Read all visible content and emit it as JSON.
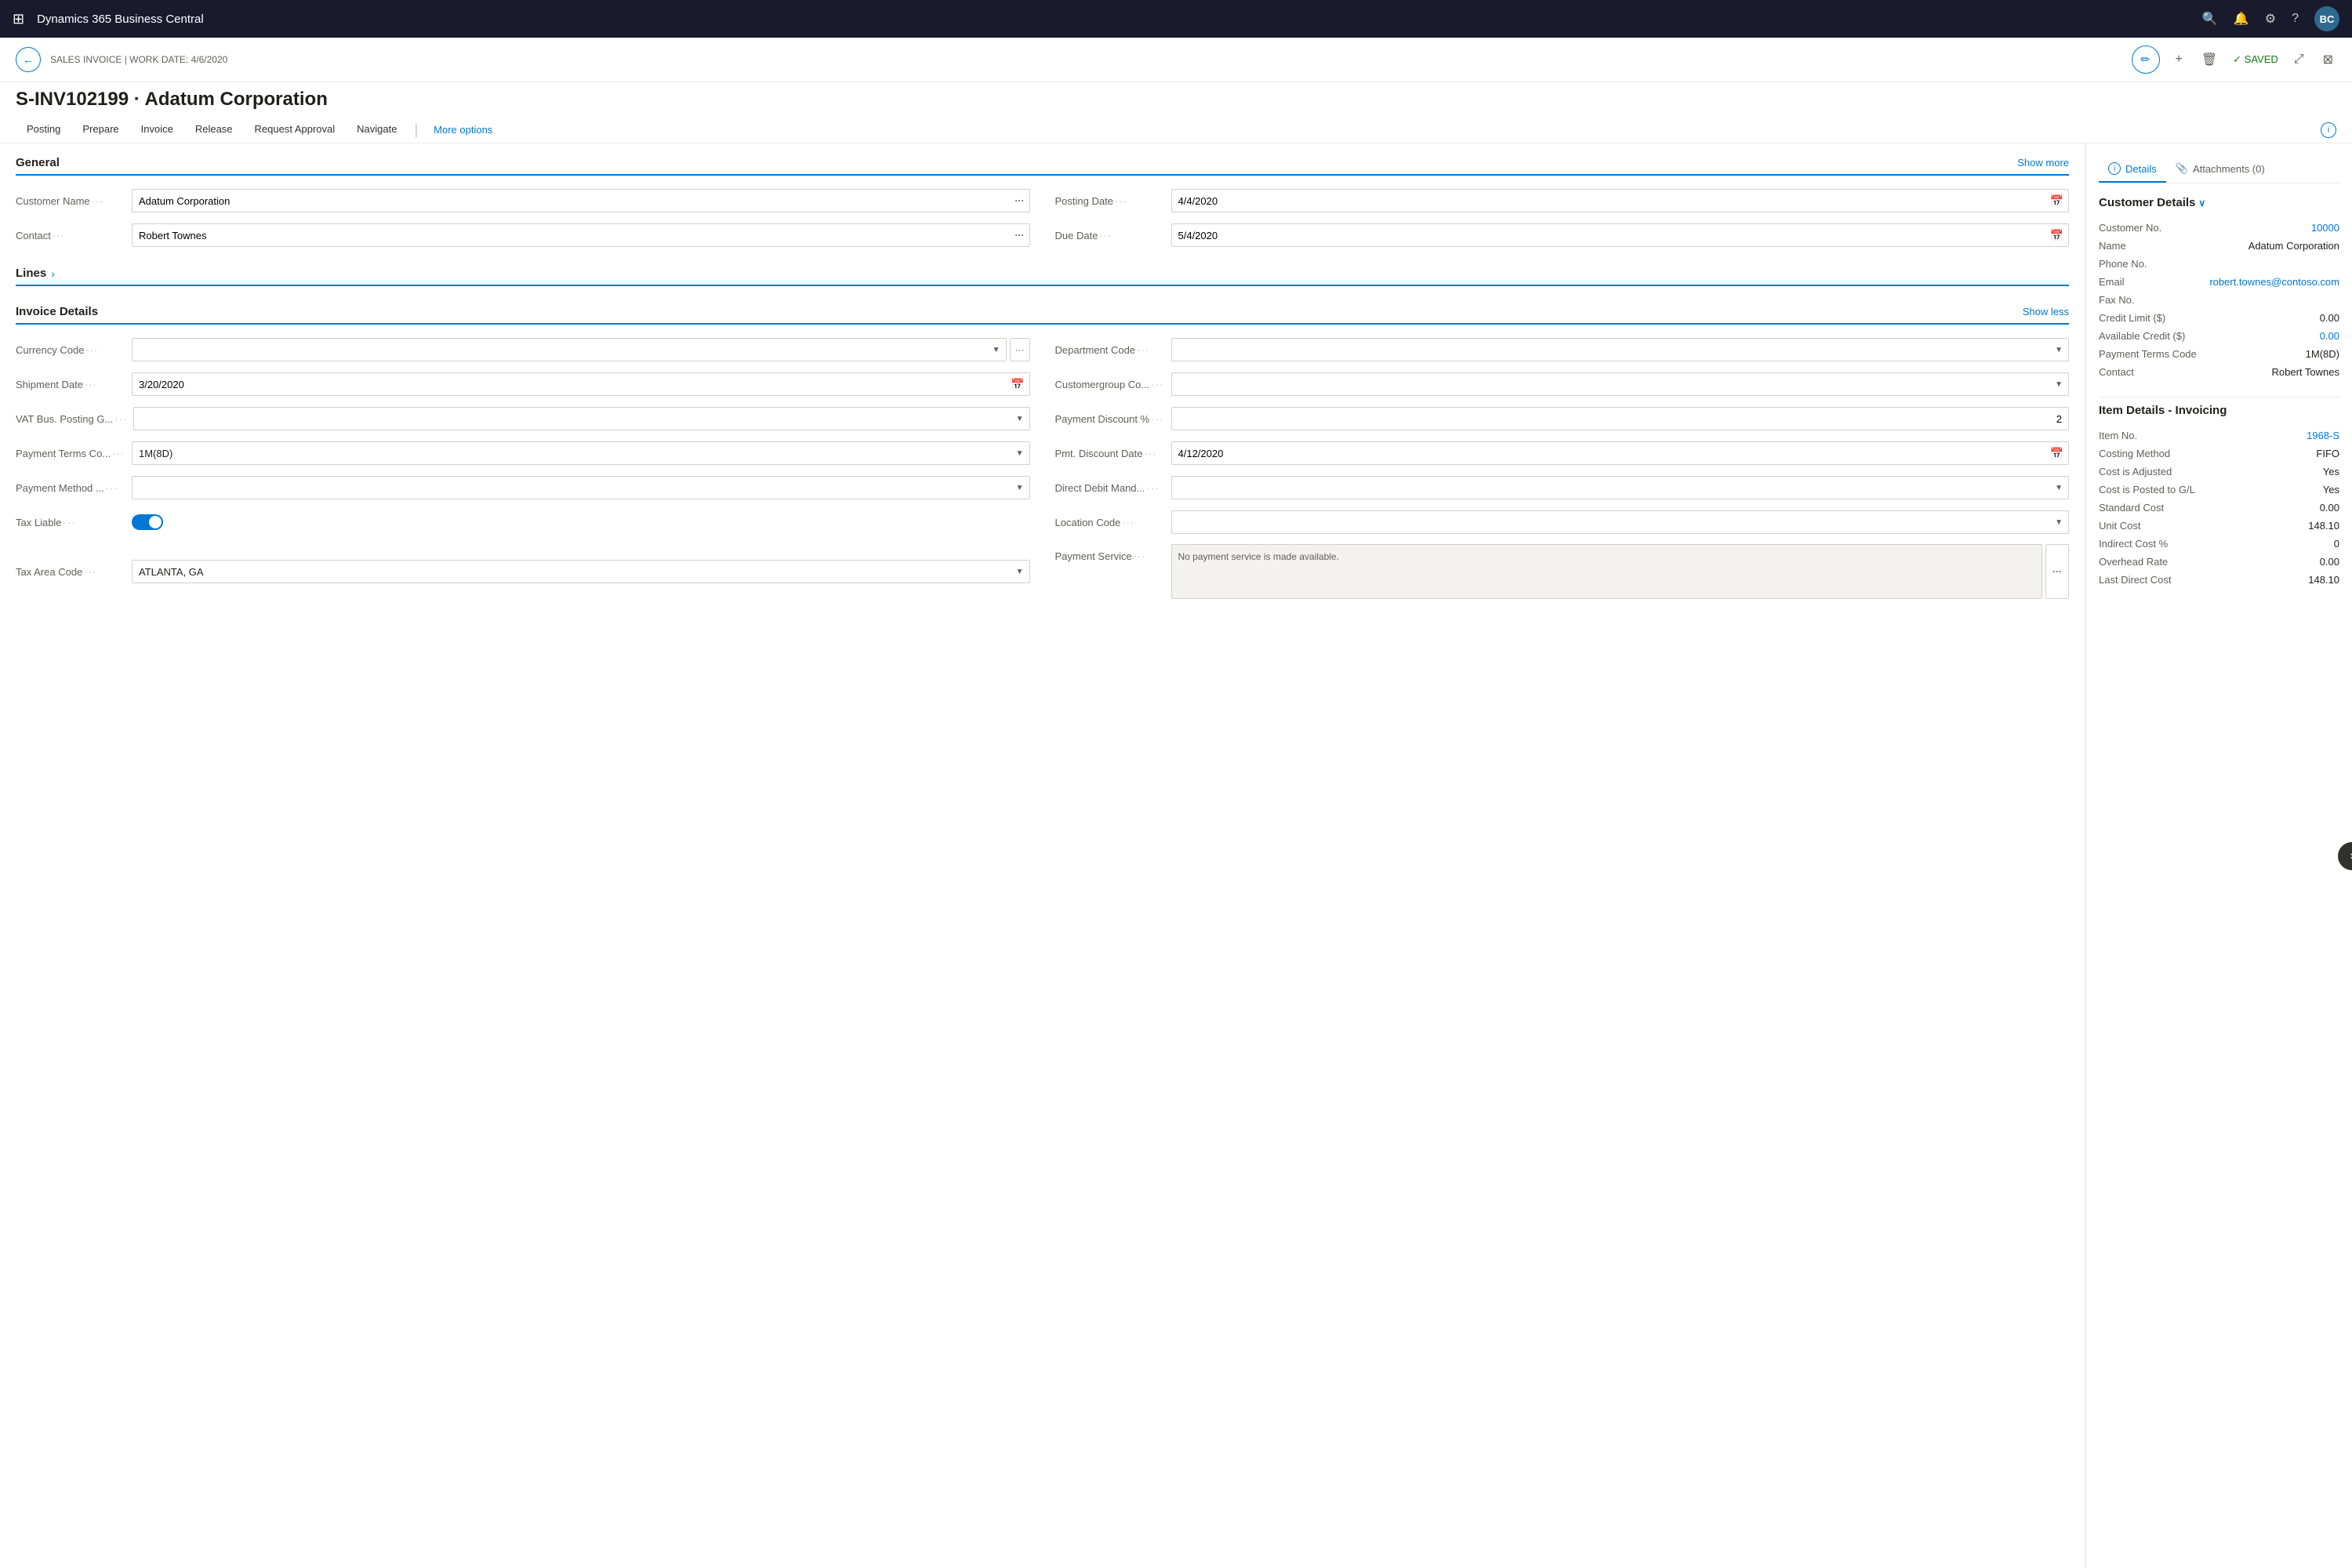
{
  "app": {
    "title": "Dynamics 365 Business Central",
    "avatar": "BC"
  },
  "header": {
    "breadcrumb": "SALES INVOICE | WORK DATE: 4/6/2020",
    "back_label": "←",
    "title": "S-INV102199 · Adatum Corporation",
    "saved_label": "✓ SAVED",
    "edit_icon": "✏",
    "add_icon": "+",
    "delete_icon": "🗑",
    "expand_icon": "⤢",
    "collapse_icon": "⊠"
  },
  "tabs": {
    "items": [
      {
        "label": "Posting"
      },
      {
        "label": "Prepare"
      },
      {
        "label": "Invoice"
      },
      {
        "label": "Release"
      },
      {
        "label": "Request Approval"
      },
      {
        "label": "Navigate"
      }
    ],
    "more_label": "More options"
  },
  "general": {
    "title": "General",
    "show_more_label": "Show more",
    "customer_name_label": "Customer Name",
    "customer_name_value": "Adatum Corporation",
    "contact_label": "Contact",
    "contact_value": "Robert Townes",
    "posting_date_label": "Posting Date",
    "posting_date_value": "4/4/2020",
    "due_date_label": "Due Date",
    "due_date_value": "5/4/2020"
  },
  "lines": {
    "title": "Lines"
  },
  "invoice_details": {
    "title": "Invoice Details",
    "show_label": "Show less",
    "currency_code_label": "Currency Code",
    "currency_code_value": "",
    "department_code_label": "Department Code",
    "department_code_value": "",
    "shipment_date_label": "Shipment Date",
    "shipment_date_value": "3/20/2020",
    "customergroup_label": "Customergroup Co...",
    "customergroup_value": "",
    "vat_bus_label": "VAT Bus. Posting G...",
    "vat_bus_value": "",
    "payment_discount_label": "Payment Discount %",
    "payment_discount_value": "2",
    "payment_terms_label": "Payment Terms Co...",
    "payment_terms_value": "1M(8D)",
    "pmt_discount_date_label": "Pmt. Discount Date",
    "pmt_discount_date_value": "4/12/2020",
    "payment_method_label": "Payment Method ...",
    "payment_method_value": "",
    "direct_debit_label": "Direct Debit Mand...",
    "direct_debit_value": "",
    "tax_liable_label": "Tax Liable",
    "location_code_label": "Location Code",
    "location_code_value": "",
    "tax_area_label": "Tax Area Code",
    "tax_area_value": "ATLANTA, GA",
    "payment_service_label": "Payment Service",
    "payment_service_text": "No payment service is made available."
  },
  "right_panel": {
    "tabs": [
      {
        "label": "Details",
        "icon": "ℹ",
        "active": true
      },
      {
        "label": "Attachments (0)",
        "icon": "📎",
        "active": false
      }
    ],
    "customer_details": {
      "title": "Customer Details",
      "fields": [
        {
          "label": "Customer No.",
          "value": "10000",
          "link": true
        },
        {
          "label": "Name",
          "value": "Adatum Corporation",
          "link": false
        },
        {
          "label": "Phone No.",
          "value": "",
          "link": false
        },
        {
          "label": "Email",
          "value": "robert.townes@contoso.com",
          "link": true
        },
        {
          "label": "Fax No.",
          "value": "",
          "link": false
        },
        {
          "label": "Credit Limit ($)",
          "value": "0.00",
          "link": false
        },
        {
          "label": "Available Credit ($)",
          "value": "0.00",
          "link": true
        },
        {
          "label": "Payment Terms Code",
          "value": "1M(8D)",
          "link": false
        },
        {
          "label": "Contact",
          "value": "Robert Townes",
          "link": false
        }
      ]
    },
    "item_details": {
      "title": "Item Details - Invoicing",
      "fields": [
        {
          "label": "Item No.",
          "value": "1968-S",
          "link": true
        },
        {
          "label": "Costing Method",
          "value": "FIFO",
          "link": false
        },
        {
          "label": "Cost is Adjusted",
          "value": "Yes",
          "link": false
        },
        {
          "label": "Cost is Posted to G/L",
          "value": "Yes",
          "link": false
        },
        {
          "label": "Standard Cost",
          "value": "0.00",
          "link": false
        },
        {
          "label": "Unit Cost",
          "value": "148.10",
          "link": false
        },
        {
          "label": "Indirect Cost %",
          "value": "0",
          "link": false
        },
        {
          "label": "Overhead Rate",
          "value": "0.00",
          "link": false
        },
        {
          "label": "Last Direct Cost",
          "value": "148.10",
          "link": false
        }
      ]
    }
  }
}
